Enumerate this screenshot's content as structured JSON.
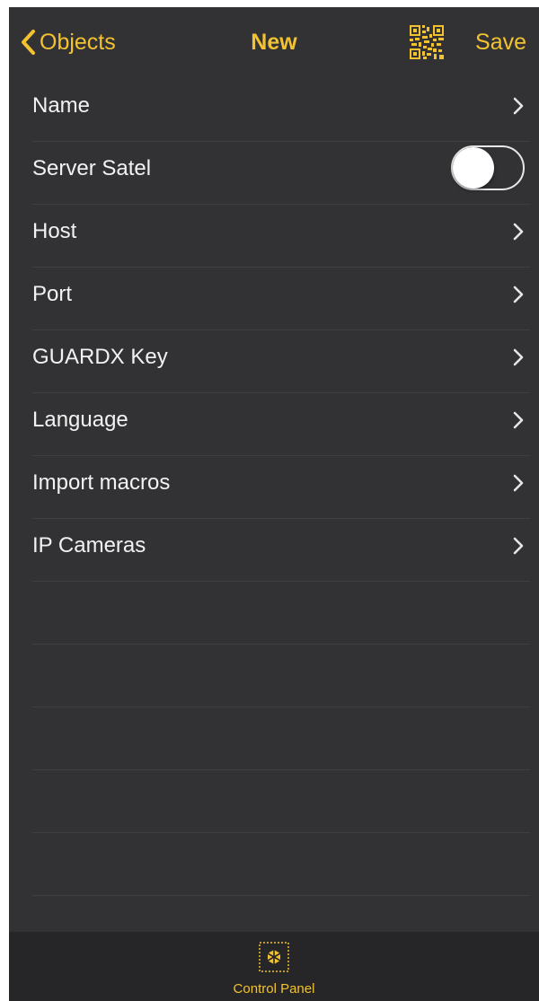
{
  "navbar": {
    "back_label": "Objects",
    "title": "New",
    "save_label": "Save",
    "qr_icon": "qr-code-icon"
  },
  "settings": [
    {
      "label": "Name",
      "control": "chevron"
    },
    {
      "label": "Server Satel",
      "control": "toggle",
      "value": false
    },
    {
      "label": "Host",
      "control": "chevron"
    },
    {
      "label": "Port",
      "control": "chevron"
    },
    {
      "label": "GUARDX Key",
      "control": "chevron"
    },
    {
      "label": "Language",
      "control": "chevron"
    },
    {
      "label": "Import macros",
      "control": "chevron"
    },
    {
      "label": "IP Cameras",
      "control": "chevron"
    }
  ],
  "tabbar": {
    "items": [
      {
        "label": "Control Panel",
        "icon": "control-panel-icon",
        "selected": true
      }
    ]
  },
  "colors": {
    "accent": "#f2c230",
    "background": "#323235",
    "tabbar_background": "#262628",
    "text": "#f2f2f2"
  }
}
